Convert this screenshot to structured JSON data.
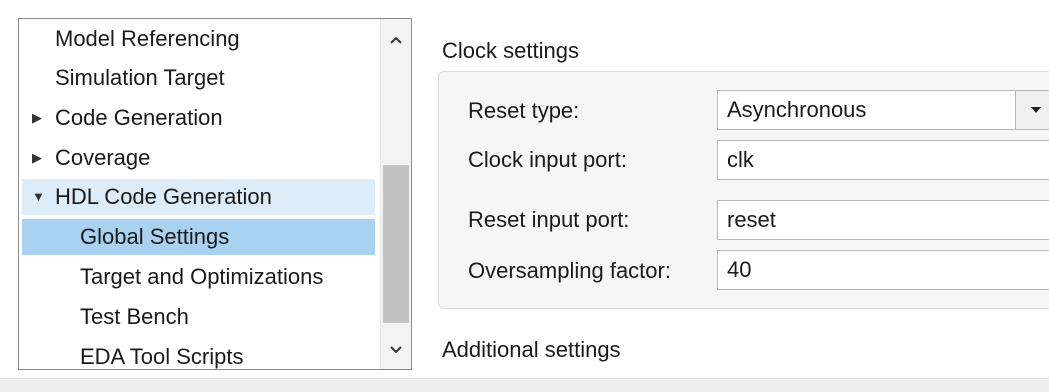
{
  "tree": {
    "items": [
      {
        "label": "Model Referencing",
        "arrow": ""
      },
      {
        "label": "Simulation Target",
        "arrow": ""
      },
      {
        "label": "Code Generation",
        "arrow": "▶"
      },
      {
        "label": "Coverage",
        "arrow": "▶"
      },
      {
        "label": "HDL Code Generation",
        "arrow": "▼"
      },
      {
        "label": "Global Settings",
        "arrow": ""
      },
      {
        "label": "Target and Optimizations",
        "arrow": ""
      },
      {
        "label": "Test Bench",
        "arrow": ""
      },
      {
        "label": "EDA Tool Scripts",
        "arrow": ""
      }
    ],
    "selected": "Global Settings"
  },
  "clock_settings": {
    "title": "Clock settings",
    "reset_type": {
      "label": "Reset type:",
      "value": "Asynchronous"
    },
    "clock_input_port": {
      "label": "Clock input port:",
      "value": "clk"
    },
    "reset_input_port": {
      "label": "Reset input port:",
      "value": "reset"
    },
    "oversampling_factor": {
      "label": "Oversampling factor:",
      "value": "40"
    }
  },
  "additional_settings": {
    "title": "Additional settings"
  },
  "icons": {
    "scroll_up": "chevron-up-icon",
    "scroll_down": "chevron-down-icon",
    "dropdown": "caret-down-icon",
    "expand": "triangle-right-icon",
    "collapse": "triangle-down-icon"
  },
  "colors": {
    "selected_bg": "#a9d1f0",
    "expanded_parent_bg": "#dcecf8",
    "group_bg": "#f6f6f6"
  }
}
